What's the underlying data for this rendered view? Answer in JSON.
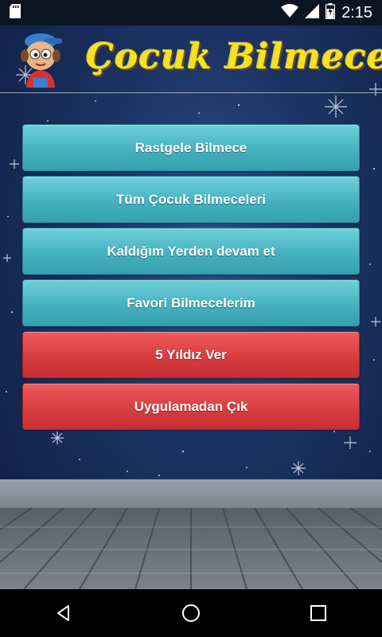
{
  "status_bar": {
    "time": "2:15",
    "icons": [
      "sd-card-icon",
      "wifi-icon",
      "cell-signal-icon",
      "battery-charging-icon"
    ]
  },
  "header": {
    "title": "Çocuk Bilmeceleri",
    "title_color": "#f6e31c",
    "mascot_icon": "kid-mascot-icon"
  },
  "menu": {
    "items": [
      {
        "label": "Rastgele Bilmece",
        "color": "#45b1bf"
      },
      {
        "label": "Tüm Çocuk Bilmeceleri",
        "color": "#45b1bf"
      },
      {
        "label": "Kaldığım Yerden devam et",
        "color": "#45b1bf"
      },
      {
        "label": "Favori Bilmecelerim",
        "color": "#45b1bf"
      },
      {
        "label": "5 Yıldız Ver",
        "color": "#d83c3f"
      },
      {
        "label": "Uygulamadan Çık",
        "color": "#d83c3f"
      }
    ]
  },
  "nav_bar": {
    "icons": [
      "back-icon",
      "home-icon",
      "recents-icon"
    ]
  }
}
